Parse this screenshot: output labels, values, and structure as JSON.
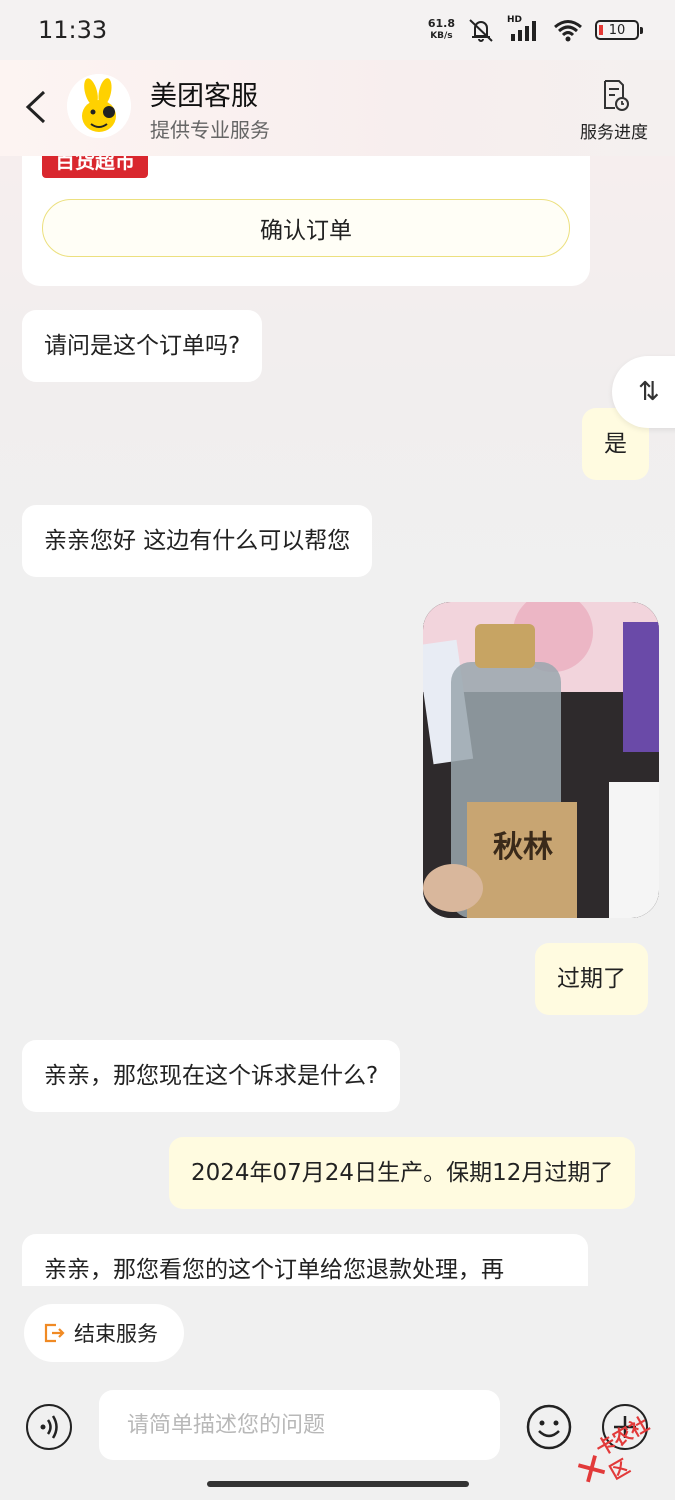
{
  "status_bar": {
    "time": "11:33",
    "net_speed_value": "61.8",
    "net_speed_unit": "KB/s",
    "signal_label": "HD",
    "battery": "10"
  },
  "header": {
    "title": "美团客服",
    "subtitle": "提供专业服务",
    "progress_label": "服务进度"
  },
  "order_card": {
    "tag": "百货超市",
    "confirm_label": "确认订单"
  },
  "messages": [
    {
      "side": "left",
      "text": "请问是这个订单吗?"
    },
    {
      "side": "right",
      "text": "是"
    },
    {
      "side": "left",
      "text": "亲亲您好 这边有什么可以帮您"
    },
    {
      "side": "right",
      "type": "image",
      "text": "秋林"
    },
    {
      "side": "right",
      "text": "过期了"
    },
    {
      "side": "left",
      "text": "亲亲，那您现在这个诉求是什么?"
    },
    {
      "side": "right",
      "text": "2024年07月24日生产。保期12月过期了"
    },
    {
      "side": "left",
      "text": "亲亲，那您看您的这个订单给您退款处理，再"
    }
  ],
  "actions": {
    "end_service": "结束服务"
  },
  "input": {
    "placeholder": "请简单描述您的问题"
  },
  "watermark": "卡农社区",
  "colors": {
    "accent_yellow": "#ffd100",
    "user_bubble": "#fffbe0",
    "tag_red": "#d9272e"
  }
}
